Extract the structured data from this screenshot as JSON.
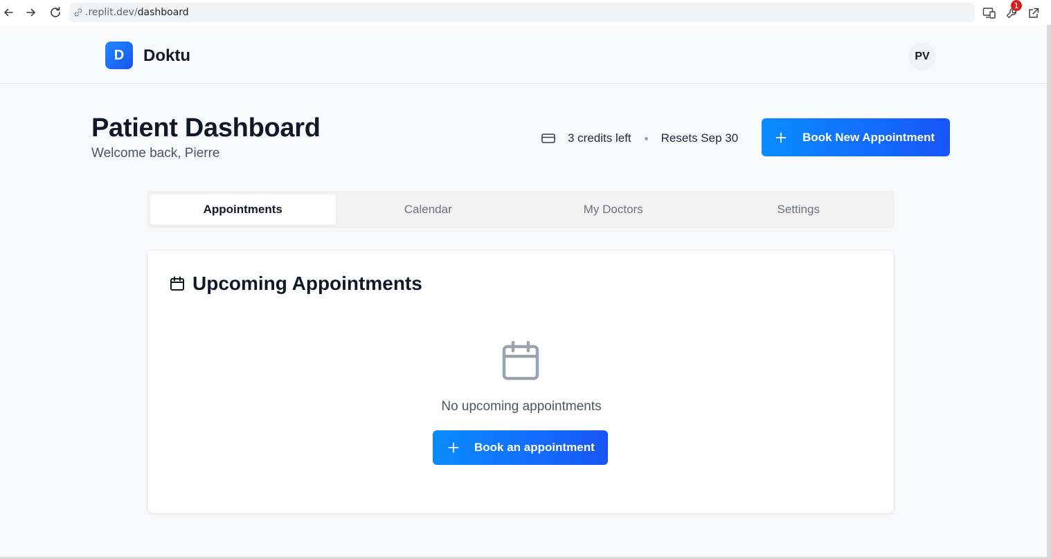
{
  "browser": {
    "url_host": ".replit.dev/",
    "url_path": "dashboard",
    "extension_badge": "1"
  },
  "header": {
    "logo_letter": "D",
    "brand": "Doktu",
    "avatar_initials": "PV"
  },
  "dashboard": {
    "title": "Patient Dashboard",
    "subtitle": "Welcome back, Pierre",
    "credits_text": "3 credits left",
    "reset_text": "Resets Sep 30",
    "book_new_label": "Book New Appointment"
  },
  "tabs": [
    {
      "label": "Appointments",
      "active": true
    },
    {
      "label": "Calendar",
      "active": false
    },
    {
      "label": "My Doctors",
      "active": false
    },
    {
      "label": "Settings",
      "active": false
    }
  ],
  "upcoming": {
    "title": "Upcoming Appointments",
    "empty_text": "No upcoming appointments",
    "book_label": "Book an appointment"
  },
  "icons": {
    "back": "arrow-left-icon",
    "forward": "arrow-right-icon",
    "reload": "reload-icon",
    "link": "link-icon",
    "cast": "cast-icon",
    "extension": "wrench-icon",
    "open_external": "external-link-icon",
    "credits": "credit-card-icon",
    "plus": "plus-icon",
    "calendar": "calendar-icon"
  },
  "colors": {
    "primary_start": "#0a8cff",
    "primary_end": "#1955f7",
    "background": "#f8f9fb",
    "text": "#111827",
    "muted": "#4b5563"
  }
}
